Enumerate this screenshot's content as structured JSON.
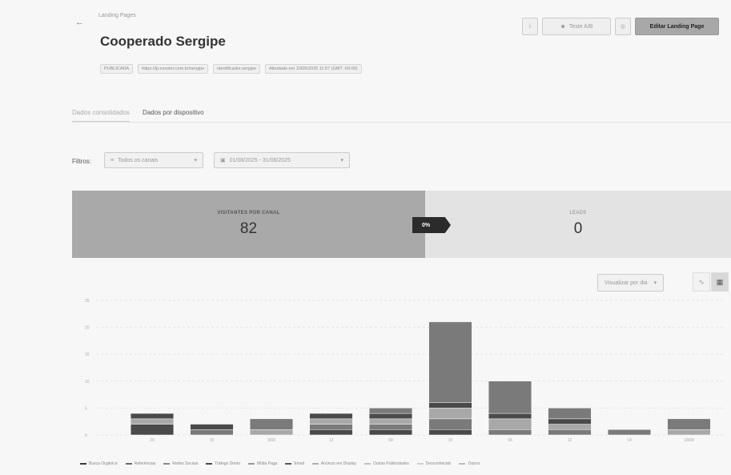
{
  "header": {
    "breadcrumb": "Landing Pages",
    "title": "Cooperado Sergipe",
    "back_icon": "arrow-left-icon",
    "meta": [
      "PUBLICADA",
      "https://lp.exoster.com.br/sergipe",
      "identificador.sergipe",
      "Atleidade em 10/05/2025 11:57 (GMT -03:00)"
    ]
  },
  "actions": {
    "info_label": "i",
    "test_ab_label": "Teste A/B",
    "preview_label": "◎",
    "edit_label": "Editar Landing Page"
  },
  "tabs": [
    "Dados consolidados",
    "Dados por dispositivo"
  ],
  "filters": {
    "label": "Filtros:",
    "channel": "Todos os canais",
    "date_range": "01/08/2025 - 31/08/2025"
  },
  "metrics": {
    "visitors_label": "VISITANTES POR CANAL",
    "visitors_value": "82",
    "conversion": "0%",
    "leads_label": "LEADS",
    "leads_value": "0"
  },
  "chart_controls": {
    "view_label": "Visualizar por dia"
  },
  "colors": {
    "dark": "#4a4a4a",
    "mid": "#7a7a7a",
    "light": "#a8a8a8",
    "lighter": "#c6c6c6"
  },
  "chart_data": {
    "type": "bar",
    "stacked": true,
    "yticks": [
      "25",
      "20",
      "15",
      "10",
      "5",
      "0"
    ],
    "ylim": [
      0,
      25
    ],
    "categories": [
      "20",
      "10",
      "3/08",
      "12",
      "09",
      "10",
      "06",
      "12",
      "14",
      "18/08"
    ],
    "series": [
      {
        "name": "Busca Orgânica",
        "values": [
          2,
          0,
          0,
          1,
          1,
          1,
          0,
          0,
          0,
          0
        ]
      },
      {
        "name": "Referências",
        "values": [
          0,
          1,
          0,
          1,
          1,
          2,
          1,
          1,
          0,
          0
        ]
      },
      {
        "name": "Redes Sociais",
        "values": [
          1,
          0,
          1,
          1,
          1,
          2,
          2,
          1,
          0,
          1
        ]
      },
      {
        "name": "Tráfego Direto",
        "values": [
          1,
          1,
          0,
          1,
          1,
          1,
          1,
          1,
          0,
          0
        ]
      },
      {
        "name": "Mídia Paga",
        "values": [
          0,
          0,
          2,
          0,
          1,
          15,
          6,
          2,
          1,
          2
        ]
      }
    ],
    "legend": [
      "Busca Orgânica",
      "Referências",
      "Redes Sociais",
      "Tráfego Direto",
      "Mídia Paga",
      "Email",
      "Anúncio em Display",
      "Outras Publicidades",
      "Desconhecido",
      "Outros"
    ]
  }
}
